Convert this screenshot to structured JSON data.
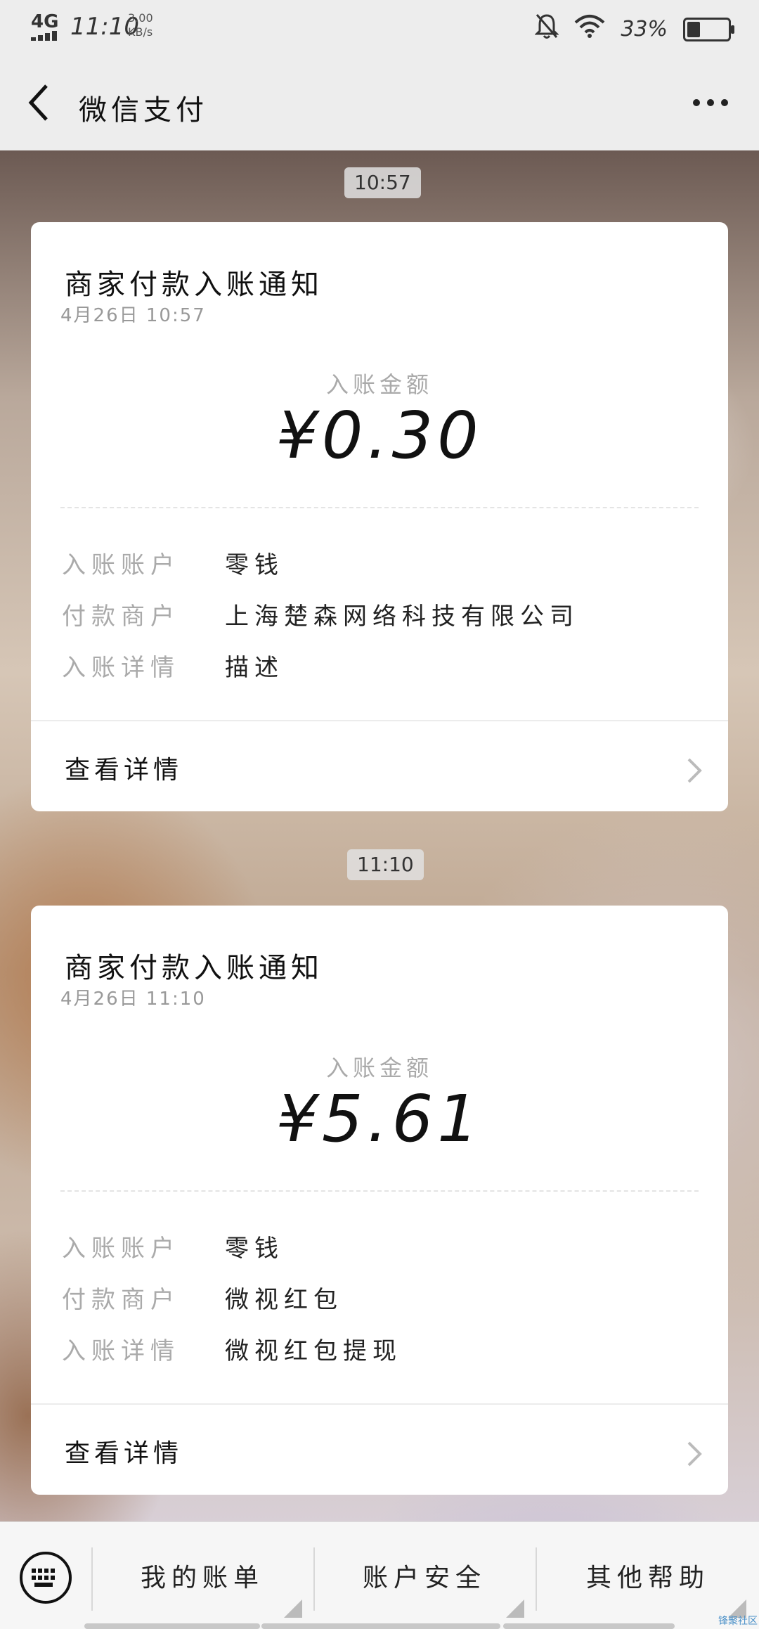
{
  "status_bar": {
    "network": "4G",
    "time": "11:10",
    "speed_value": "3.00",
    "speed_unit": "KB/s",
    "battery": "33%",
    "battery_level": 0.33
  },
  "nav": {
    "title": "微信支付"
  },
  "messages": [
    {
      "time_chip": "10:57",
      "title": "商家付款入账通知",
      "date": "4月26日  10:57",
      "amount_label": "入账金额",
      "amount": "¥0.30",
      "rows": [
        {
          "key": "入账账户",
          "value": "零钱"
        },
        {
          "key": "付款商户",
          "value": "上海楚森网络科技有限公司"
        },
        {
          "key": "入账详情",
          "value": "描述"
        }
      ],
      "detail_link": "查看详情"
    },
    {
      "time_chip": "11:10",
      "title": "商家付款入账通知",
      "date": "4月26日  11:10",
      "amount_label": "入账金额",
      "amount": "¥5.61",
      "rows": [
        {
          "key": "入账账户",
          "value": "零钱"
        },
        {
          "key": "付款商户",
          "value": "微视红包"
        },
        {
          "key": "入账详情",
          "value": "微视红包提现"
        }
      ],
      "detail_link": "查看详情"
    }
  ],
  "bottom_menu": {
    "items": [
      "我的账单",
      "账户安全",
      "其他帮助"
    ]
  },
  "watermark": "锋聚社区",
  "colors": {
    "nav_bg": "#ededed",
    "card_bg": "#ffffff",
    "muted_text": "#aaaaaa",
    "primary_text": "#111111"
  }
}
